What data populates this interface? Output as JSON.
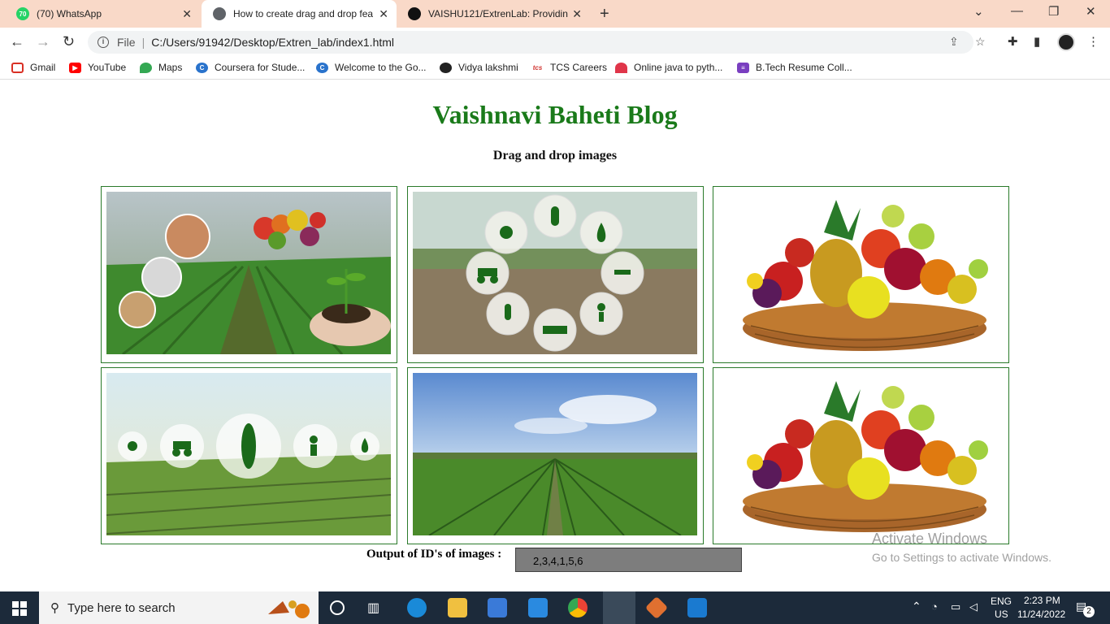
{
  "browser": {
    "tabs": [
      {
        "title": "(70) WhatsApp",
        "badge": "70"
      },
      {
        "title": "How to create drag and drop fea"
      },
      {
        "title": "VAISHU121/ExtrenLab: Providing"
      }
    ],
    "address": {
      "scheme": "File",
      "url": "C:/Users/91942/Desktop/Extren_lab/index1.html"
    },
    "bookmarks": [
      {
        "label": "Gmail"
      },
      {
        "label": "YouTube"
      },
      {
        "label": "Maps"
      },
      {
        "label": "Coursera for Stude..."
      },
      {
        "label": "Welcome to the Go..."
      },
      {
        "label": "Vidya lakshmi"
      },
      {
        "label": "TCS Careers"
      },
      {
        "label": "Online java to pyth..."
      },
      {
        "label": "B.Tech Resume Coll..."
      }
    ]
  },
  "page": {
    "title": "Vaishnavi Baheti Blog",
    "subtitle": "Drag and drop images",
    "output_label": "Output of ID's of images :",
    "output_value": "2,3,4,1,5,6",
    "images": [
      {
        "name": "farm-seeds-vegetables-image"
      },
      {
        "name": "smart-farming-icons-image"
      },
      {
        "name": "fruit-basket-image"
      },
      {
        "name": "agritech-field-icons-image"
      },
      {
        "name": "green-field-sky-image"
      },
      {
        "name": "fruit-basket-image-2"
      }
    ]
  },
  "watermark": {
    "line1": "Activate Windows",
    "line2": "Go to Settings to activate Windows."
  },
  "taskbar": {
    "search_placeholder": "Type here to search",
    "lang": "ENG",
    "region": "US",
    "time": "2:23 PM",
    "date": "11/24/2022",
    "notifications": "2"
  },
  "colors": {
    "heading": "#1a7a1a",
    "tabstrip": "#f9d9c8",
    "border": "#2a7a2a"
  }
}
